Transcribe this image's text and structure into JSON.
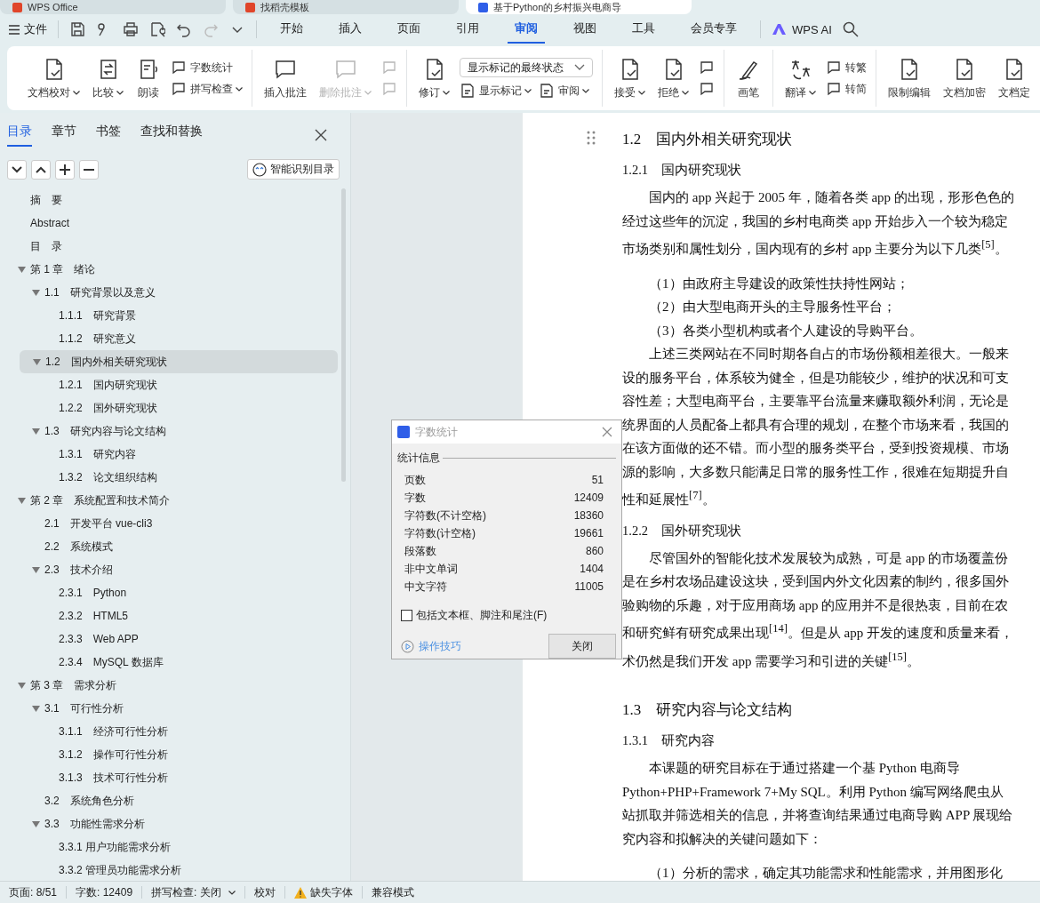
{
  "window_tabs": [
    {
      "title": "WPS Office",
      "selected": false
    },
    {
      "title": "找稻壳模板",
      "selected": false
    },
    {
      "title": "基于Python的乡村振兴电商导",
      "selected": true
    }
  ],
  "menu": {
    "file": "文件",
    "quick_access": [
      {
        "disabled": false
      },
      {
        "disabled": false
      },
      {
        "disabled": false
      },
      {
        "disabled": false
      },
      {
        "disabled": false
      },
      {
        "disabled": true
      },
      {
        "disabled": false
      }
    ],
    "tabs": [
      {
        "label": "开始",
        "selected": false
      },
      {
        "label": "插入",
        "selected": false
      },
      {
        "label": "页面",
        "selected": false
      },
      {
        "label": "引用",
        "selected": false
      },
      {
        "label": "审阅",
        "selected": true
      },
      {
        "label": "视图",
        "selected": false
      },
      {
        "label": "工具",
        "selected": false
      },
      {
        "label": "会员专享",
        "selected": false
      }
    ],
    "ai": "WPS AI"
  },
  "ribbon": [
    {
      "items": [
        {
          "kind": "big",
          "label": "文档校对",
          "dropdown": true,
          "disabled": false
        },
        {
          "kind": "big",
          "label": "比较",
          "dropdown": true,
          "disabled": false
        },
        {
          "kind": "big",
          "label": "朗读",
          "dropdown": false,
          "disabled": false
        },
        {
          "kind": "stack",
          "items": [
            {
              "label": "字数统计",
              "dropdown": false,
              "disabled": false
            },
            {
              "label": "拼写检查",
              "dropdown": true,
              "disabled": false
            }
          ]
        }
      ]
    },
    {
      "items": [
        {
          "kind": "big",
          "label": "插入批注",
          "dropdown": false,
          "disabled": false
        },
        {
          "kind": "big",
          "label": "删除批注",
          "dropdown": true,
          "disabled": true
        },
        {
          "kind": "stack",
          "items": [
            {
              "dropdown": false,
              "disabled": true
            },
            {
              "dropdown": false,
              "disabled": true
            }
          ]
        }
      ]
    },
    {
      "items": [
        {
          "kind": "big",
          "label": "修订",
          "dropdown": true,
          "disabled": false
        },
        {
          "kind": "select",
          "value": "显示标记的最终状态",
          "items": [
            {
              "label": "显示标记",
              "dropdown": true,
              "disabled": false
            },
            {
              "label": "审阅",
              "dropdown": true,
              "disabled": false
            }
          ]
        }
      ]
    },
    {
      "items": [
        {
          "kind": "big",
          "label": "接受",
          "dropdown": true,
          "disabled": false
        },
        {
          "kind": "big",
          "label": "拒绝",
          "dropdown": true,
          "disabled": false
        },
        {
          "kind": "stack",
          "items": [
            {
              "dropdown": false,
              "disabled": false
            },
            {
              "dropdown": false,
              "disabled": false
            }
          ]
        }
      ]
    },
    {
      "items": [
        {
          "kind": "big",
          "label": "画笔",
          "dropdown": false,
          "disabled": false
        }
      ]
    },
    {
      "items": [
        {
          "kind": "big",
          "label": "翻译",
          "dropdown": true,
          "disabled": false
        },
        {
          "kind": "stack",
          "items": [
            {
              "label": "转繁",
              "dropdown": false,
              "disabled": false
            },
            {
              "label": "转简",
              "dropdown": false,
              "disabled": false
            }
          ]
        }
      ]
    },
    {
      "items": [
        {
          "kind": "big",
          "label": "限制编辑",
          "dropdown": false,
          "disabled": false
        },
        {
          "kind": "big",
          "label": "文档加密",
          "dropdown": false,
          "disabled": false
        },
        {
          "kind": "big",
          "label": "文档定",
          "dropdown": false,
          "disabled": false
        }
      ]
    }
  ],
  "sidebar": {
    "tabs": [
      {
        "label": "目录",
        "selected": true
      },
      {
        "label": "章节",
        "selected": false
      },
      {
        "label": "书签",
        "selected": false
      },
      {
        "label": "查找和替换",
        "selected": false
      }
    ],
    "smart_button": "智能识别目录",
    "toc": [
      {
        "label": "摘　要",
        "selected": false
      },
      {
        "label": "Abstract",
        "selected": false
      },
      {
        "label": "目　录",
        "selected": false
      },
      {
        "label": "第 1 章　绪论",
        "selected": false,
        "expanded": true,
        "children": [
          {
            "label": "1.1　研究背景以及意义",
            "selected": false,
            "expanded": true,
            "children": [
              {
                "label": "1.1.1　研究背景",
                "selected": false
              },
              {
                "label": "1.1.2　研究意义",
                "selected": false
              }
            ]
          },
          {
            "label": "1.2　国内外相关研究现状",
            "selected": true,
            "expanded": true,
            "children": [
              {
                "label": "1.2.1　国内研究现状",
                "selected": false
              },
              {
                "label": "1.2.2　国外研究现状",
                "selected": false
              }
            ]
          },
          {
            "label": "1.3　研究内容与论文结构",
            "selected": false,
            "expanded": true,
            "children": [
              {
                "label": "1.3.1　研究内容",
                "selected": false
              },
              {
                "label": "1.3.2　论文组织结构",
                "selected": false
              }
            ]
          }
        ]
      },
      {
        "label": "第 2 章　系统配置和技术简介",
        "selected": false,
        "expanded": true,
        "children": [
          {
            "label": "2.1　开发平台 vue-cli3",
            "selected": false
          },
          {
            "label": "2.2　系统模式",
            "selected": false
          },
          {
            "label": "2.3　技术介绍",
            "selected": false,
            "expanded": true,
            "children": [
              {
                "label": "2.3.1　Python",
                "selected": false
              },
              {
                "label": "2.3.2　HTML5",
                "selected": false
              },
              {
                "label": "2.3.3　Web APP",
                "selected": false
              },
              {
                "label": "2.3.4　MySQL 数据库",
                "selected": false
              }
            ]
          }
        ]
      },
      {
        "label": "第 3 章　需求分析",
        "selected": false,
        "expanded": true,
        "children": [
          {
            "label": "3.1　可行性分析",
            "selected": false,
            "expanded": true,
            "children": [
              {
                "label": "3.1.1　经济可行性分析",
                "selected": false
              },
              {
                "label": "3.1.2　操作可行性分析",
                "selected": false
              },
              {
                "label": "3.1.3　技术可行性分析",
                "selected": false
              }
            ]
          },
          {
            "label": "3.2　系统角色分析",
            "selected": false
          },
          {
            "label": "3.3　功能性需求分析",
            "selected": false,
            "expanded": true,
            "children": [
              {
                "label": "3.3.1 用户功能需求分析",
                "selected": false
              },
              {
                "label": "3.3.2 管理员功能需求分析",
                "selected": false
              }
            ]
          }
        ]
      }
    ]
  },
  "document": [
    {
      "kind": "h2",
      "text": "1.2　国内外相关研究现状"
    },
    {
      "kind": "h3",
      "text": "1.2.1　国内研究现状"
    },
    {
      "kind": "para",
      "lines": [
        "国内的 app 兴起于 2005 年，随着各类 app 的出现，形形色色的",
        "经过这些年的沉淀，我国的乡村电商类 app 开始步入一个较为稳定",
        "市场类别和属性划分，国内现有的乡村 app 主要分为以下几类$^{[5]}$。"
      ]
    },
    {
      "kind": "item",
      "text": "（1）由政府主导建设的政策性扶持性网站；"
    },
    {
      "kind": "item",
      "text": "（2）由大型电商开头的主导服务性平台；"
    },
    {
      "kind": "item",
      "text": "（3）各类小型机构或者个人建设的导购平台。"
    },
    {
      "kind": "para",
      "lines": [
        "上述三类网站在不同时期各自占的市场份额相差很大。一般来",
        "设的服务平台，体系较为健全，但是功能较少，维护的状况和可支",
        "容性差；大型电商平台，主要靠平台流量来赚取额外利润，无论是",
        "统界面的人员配备上都具有合理的规划，在整个市场来看，我国的",
        "在该方面做的还不错。而小型的服务类平台，受到投资规模、市场",
        "源的影响，大多数只能满足日常的服务性工作，很难在短期提升自",
        "性和延展性$^{[7]}$。"
      ]
    },
    {
      "kind": "h3",
      "text": "1.2.2　国外研究现状"
    },
    {
      "kind": "para",
      "lines": [
        "尽管国外的智能化技术发展较为成熟，可是 app 的市场覆盖份",
        "是在乡村农场品建设这块，受到国内外文化因素的制约，很多国外",
        "验购物的乐趣，对于应用商场 app 的应用并不是很热衷，目前在农",
        "和研究鲜有研究成果出现$^{[14]}$。但是从 app 开发的速度和质量来看，",
        "术仍然是我们开发 app 需要学习和引进的关键$^{[15]}$。"
      ]
    },
    {
      "kind": "h2",
      "text": "1.3　研究内容与论文结构"
    },
    {
      "kind": "h3",
      "text": "1.3.1　研究内容"
    },
    {
      "kind": "para",
      "lines": [
        "本课题的研究目标在于通过搭建一个基 Python 电商导",
        "Python+PHP+Framework 7+My SQL。利用 Python 编写网络爬虫从",
        "站抓取并筛选相关的信息，并将查询结果通过电商导购 APP 展现给",
        "究内容和拟解决的关键问题如下："
      ]
    },
    {
      "kind": "item",
      "text": "（1）分析的需求，确定其功能需求和性能需求，并用图形化"
    }
  ],
  "dialog": {
    "title": "字数统计",
    "section": "统计信息",
    "stats": [
      {
        "label": "页数",
        "value": "51"
      },
      {
        "label": "字数",
        "value": "12409"
      },
      {
        "label": "字符数(不计空格)",
        "value": "18360"
      },
      {
        "label": "字符数(计空格)",
        "value": "19661"
      },
      {
        "label": "段落数",
        "value": "860"
      },
      {
        "label": "非中文单词",
        "value": "1404"
      },
      {
        "label": "中文字符",
        "value": "11005"
      }
    ],
    "checkbox": {
      "label": "包括文本框、脚注和尾注(F)",
      "checked": false
    },
    "tips_link": "操作技巧",
    "close_button": "关闭"
  },
  "status_bar": [
    {
      "kind": "text",
      "text": "页面: 8/51"
    },
    {
      "kind": "text",
      "text": "字数: 12409"
    },
    {
      "kind": "dropdown",
      "text": "拼写检查: 关闭"
    },
    {
      "kind": "text",
      "text": "校对"
    },
    {
      "kind": "warning",
      "text": "缺失字体"
    },
    {
      "kind": "text",
      "text": "兼容模式"
    }
  ]
}
